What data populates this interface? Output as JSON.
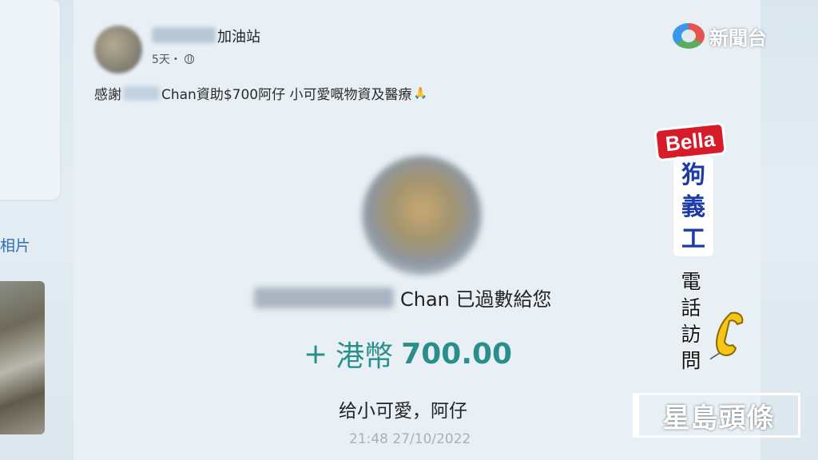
{
  "left_panel": {
    "photos_label": "相片"
  },
  "post": {
    "page_name": "加油站",
    "time": "5天・",
    "text_before": "感謝",
    "text_after": "Chan資助$700阿仔 小可愛嘅物資及醫療"
  },
  "transfer": {
    "received_text": "Chan 已過數給您",
    "amount_prefix": "+",
    "currency": "港幣",
    "amount": "700.00",
    "memo": "给小可愛，阿仔",
    "timestamp": "21:48 27/10/2022"
  },
  "overlay": {
    "channel_logo": "新聞台",
    "name_tag": "Bella",
    "role": "狗義工",
    "interview": "電話訪問",
    "watermark": "星島頭條"
  },
  "colors": {
    "amount": "#2a8f8a",
    "name_tag_bg": "#d81b2a",
    "role_text": "#1c3aa8",
    "link": "#2f6fb5"
  },
  "icons": [
    "globe-icon",
    "pray-icon",
    "phone-icon"
  ]
}
